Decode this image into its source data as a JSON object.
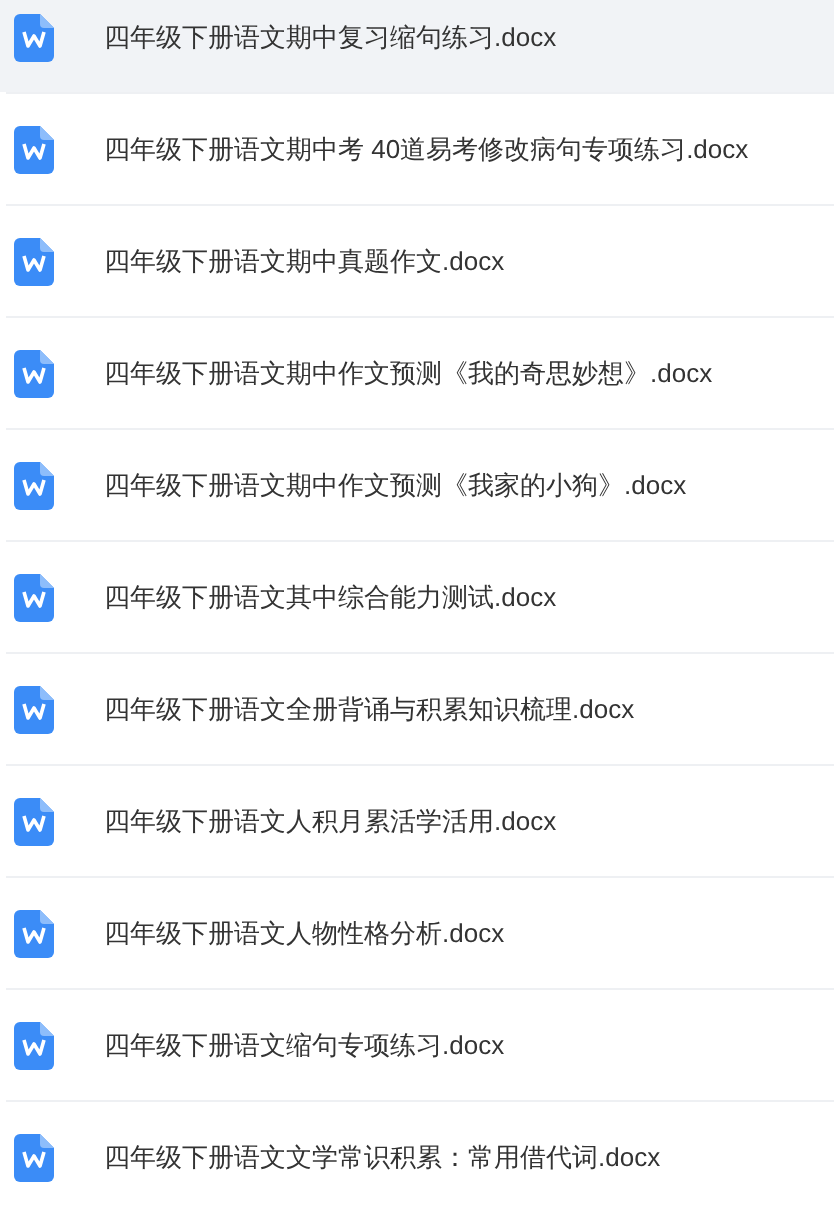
{
  "files": [
    {
      "name": "四年级下册语文期中复习缩句练习.docx",
      "selected": true
    },
    {
      "name": "四年级下册语文期中考 40道易考修改病句专项练习.docx",
      "selected": false
    },
    {
      "name": "四年级下册语文期中真题作文.docx",
      "selected": false
    },
    {
      "name": "四年级下册语文期中作文预测《我的奇思妙想》.docx",
      "selected": false
    },
    {
      "name": "四年级下册语文期中作文预测《我家的小狗》.docx",
      "selected": false
    },
    {
      "name": "四年级下册语文其中综合能力测试.docx",
      "selected": false
    },
    {
      "name": "四年级下册语文全册背诵与积累知识梳理.docx",
      "selected": false
    },
    {
      "name": "四年级下册语文人积月累活学活用.docx",
      "selected": false
    },
    {
      "name": "四年级下册语文人物性格分析.docx",
      "selected": false
    },
    {
      "name": "四年级下册语文缩句专项练习.docx",
      "selected": false
    },
    {
      "name": "四年级下册语文文学常识积累：常用借代词.docx",
      "selected": false
    }
  ]
}
